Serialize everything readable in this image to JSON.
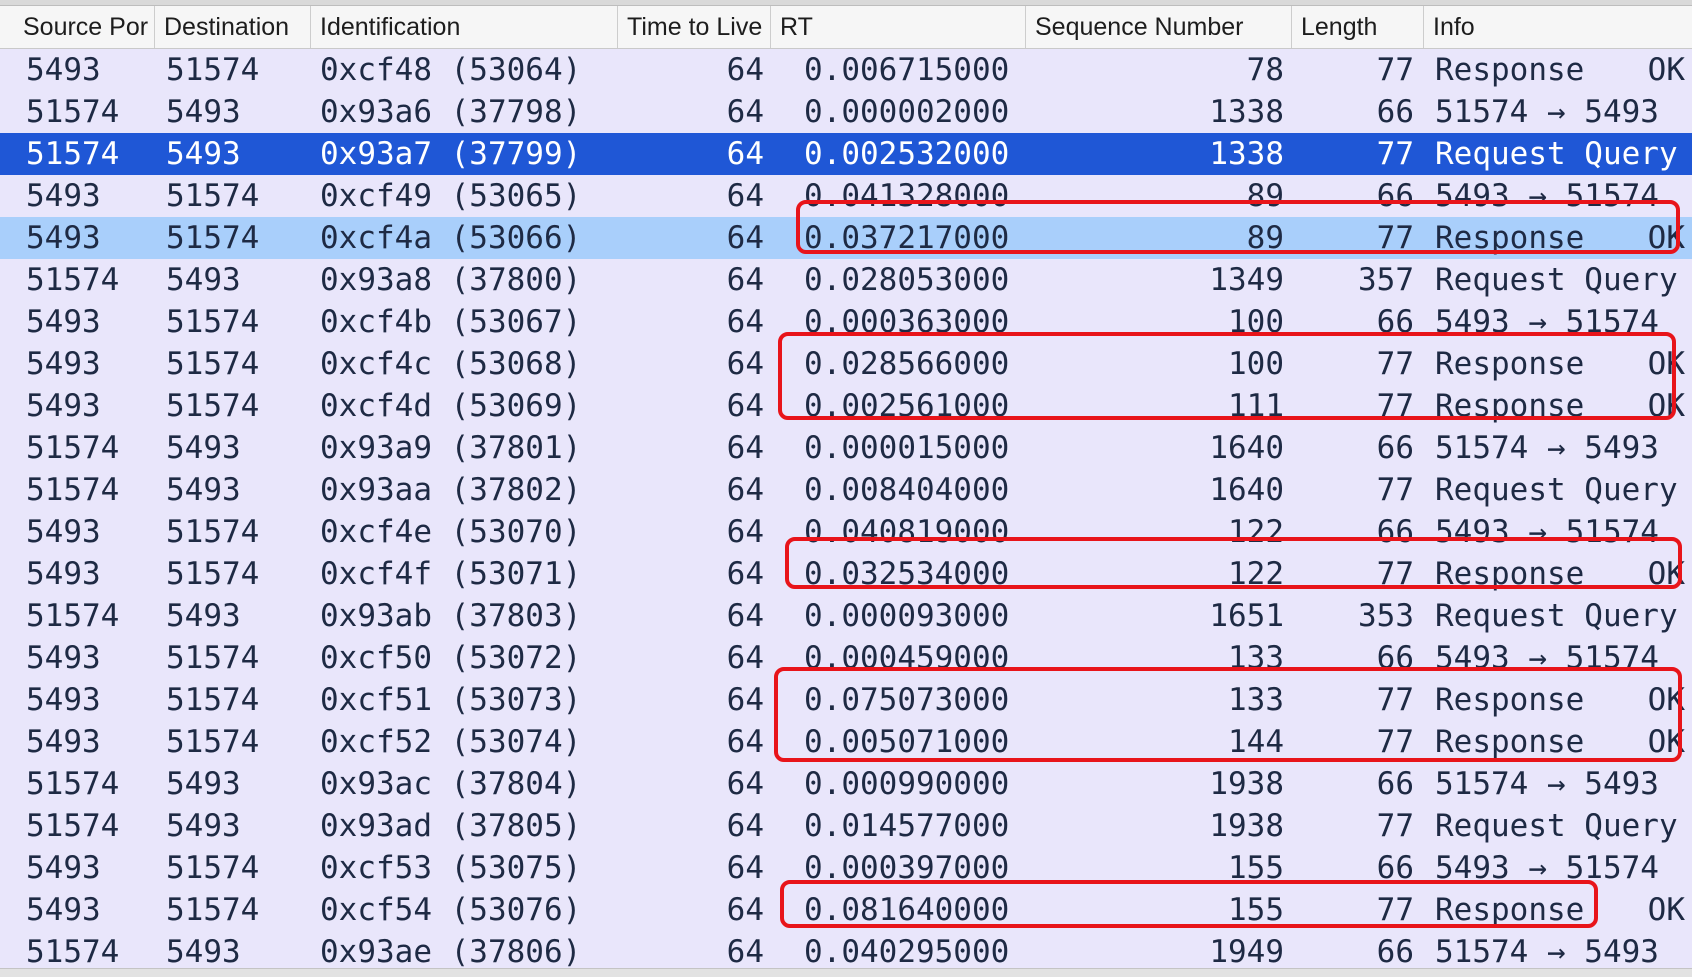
{
  "columns": [
    "Source Por",
    "Destination",
    "Identification",
    "Time to Live",
    "RT",
    "Sequence Number",
    "Length",
    "Info"
  ],
  "rows": [
    {
      "src": "5493",
      "dst": "51574",
      "id": "0xcf48 (53064)",
      "ttl": "64",
      "rt": "0.006715000",
      "seq": "78",
      "len": "77",
      "info": "Response",
      "info_ok": "OK",
      "state": "normal"
    },
    {
      "src": "51574",
      "dst": "5493",
      "id": "0x93a6 (37798)",
      "ttl": "64",
      "rt": "0.000002000",
      "seq": "1338",
      "len": "66",
      "info": "51574 → 5493",
      "info_ok": "",
      "state": "normal"
    },
    {
      "src": "51574",
      "dst": "5493",
      "id": "0x93a7 (37799)",
      "ttl": "64",
      "rt": "0.002532000",
      "seq": "1338",
      "len": "77",
      "info": "Request Query",
      "info_ok": "",
      "state": "selected"
    },
    {
      "src": "5493",
      "dst": "51574",
      "id": "0xcf49 (53065)",
      "ttl": "64",
      "rt": "0.041328000",
      "seq": "89",
      "len": "66",
      "info": "5493 → 51574",
      "info_ok": "",
      "state": "normal"
    },
    {
      "src": "5493",
      "dst": "51574",
      "id": "0xcf4a (53066)",
      "ttl": "64",
      "rt": "0.037217000",
      "seq": "89",
      "len": "77",
      "info": "Response",
      "info_ok": "OK",
      "state": "highlight"
    },
    {
      "src": "51574",
      "dst": "5493",
      "id": "0x93a8 (37800)",
      "ttl": "64",
      "rt": "0.028053000",
      "seq": "1349",
      "len": "357",
      "info": "Request Query",
      "info_ok": "",
      "state": "normal"
    },
    {
      "src": "5493",
      "dst": "51574",
      "id": "0xcf4b (53067)",
      "ttl": "64",
      "rt": "0.000363000",
      "seq": "100",
      "len": "66",
      "info": "5493 → 51574",
      "info_ok": "",
      "state": "normal"
    },
    {
      "src": "5493",
      "dst": "51574",
      "id": "0xcf4c (53068)",
      "ttl": "64",
      "rt": "0.028566000",
      "seq": "100",
      "len": "77",
      "info": "Response",
      "info_ok": "OK",
      "state": "normal"
    },
    {
      "src": "5493",
      "dst": "51574",
      "id": "0xcf4d (53069)",
      "ttl": "64",
      "rt": "0.002561000",
      "seq": "111",
      "len": "77",
      "info": "Response",
      "info_ok": "OK",
      "state": "normal"
    },
    {
      "src": "51574",
      "dst": "5493",
      "id": "0x93a9 (37801)",
      "ttl": "64",
      "rt": "0.000015000",
      "seq": "1640",
      "len": "66",
      "info": "51574 → 5493",
      "info_ok": "",
      "state": "normal"
    },
    {
      "src": "51574",
      "dst": "5493",
      "id": "0x93aa (37802)",
      "ttl": "64",
      "rt": "0.008404000",
      "seq": "1640",
      "len": "77",
      "info": "Request Query",
      "info_ok": "",
      "state": "normal"
    },
    {
      "src": "5493",
      "dst": "51574",
      "id": "0xcf4e (53070)",
      "ttl": "64",
      "rt": "0.040819000",
      "seq": "122",
      "len": "66",
      "info": "5493 → 51574",
      "info_ok": "",
      "state": "normal"
    },
    {
      "src": "5493",
      "dst": "51574",
      "id": "0xcf4f (53071)",
      "ttl": "64",
      "rt": "0.032534000",
      "seq": "122",
      "len": "77",
      "info": "Response",
      "info_ok": "OK",
      "state": "normal"
    },
    {
      "src": "51574",
      "dst": "5493",
      "id": "0x93ab (37803)",
      "ttl": "64",
      "rt": "0.000093000",
      "seq": "1651",
      "len": "353",
      "info": "Request Query",
      "info_ok": "",
      "state": "normal"
    },
    {
      "src": "5493",
      "dst": "51574",
      "id": "0xcf50 (53072)",
      "ttl": "64",
      "rt": "0.000459000",
      "seq": "133",
      "len": "66",
      "info": "5493 → 51574",
      "info_ok": "",
      "state": "normal"
    },
    {
      "src": "5493",
      "dst": "51574",
      "id": "0xcf51 (53073)",
      "ttl": "64",
      "rt": "0.075073000",
      "seq": "133",
      "len": "77",
      "info": "Response",
      "info_ok": "OK",
      "state": "normal"
    },
    {
      "src": "5493",
      "dst": "51574",
      "id": "0xcf52 (53074)",
      "ttl": "64",
      "rt": "0.005071000",
      "seq": "144",
      "len": "77",
      "info": "Response",
      "info_ok": "OK",
      "state": "normal"
    },
    {
      "src": "51574",
      "dst": "5493",
      "id": "0x93ac (37804)",
      "ttl": "64",
      "rt": "0.000990000",
      "seq": "1938",
      "len": "66",
      "info": "51574 → 5493",
      "info_ok": "",
      "state": "normal"
    },
    {
      "src": "51574",
      "dst": "5493",
      "id": "0x93ad (37805)",
      "ttl": "64",
      "rt": "0.014577000",
      "seq": "1938",
      "len": "77",
      "info": "Request Query",
      "info_ok": "",
      "state": "normal"
    },
    {
      "src": "5493",
      "dst": "51574",
      "id": "0xcf53 (53075)",
      "ttl": "64",
      "rt": "0.000397000",
      "seq": "155",
      "len": "66",
      "info": "5493 → 51574",
      "info_ok": "",
      "state": "normal"
    },
    {
      "src": "5493",
      "dst": "51574",
      "id": "0xcf54 (53076)",
      "ttl": "64",
      "rt": "0.081640000",
      "seq": "155",
      "len": "77",
      "info": "Response",
      "info_ok": "OK",
      "state": "normal"
    },
    {
      "src": "51574",
      "dst": "5493",
      "id": "0x93ae (37806)",
      "ttl": "64",
      "rt": "0.040295000",
      "seq": "1949",
      "len": "66",
      "info": "51574 → 5493",
      "info_ok": "",
      "state": "normal"
    }
  ],
  "colors": {
    "row_bg": "#e9e6fb",
    "selected_bg": "#1f57d6",
    "highlight_bg": "#a9cffb",
    "annotation": "#e8141a"
  }
}
